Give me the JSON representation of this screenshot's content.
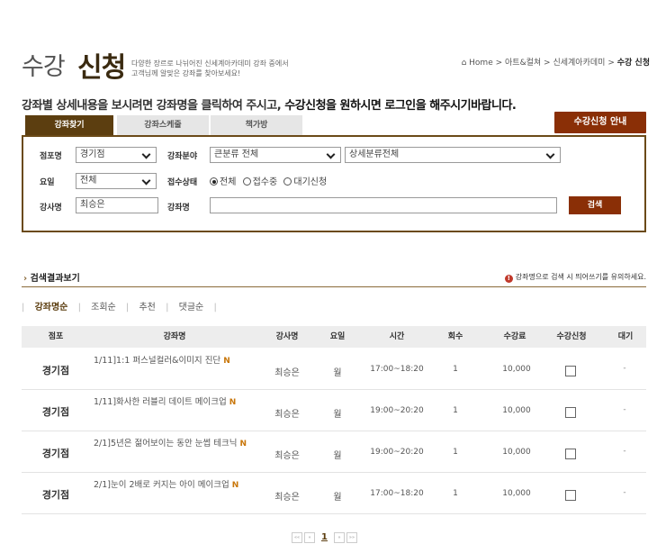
{
  "header": {
    "title_light": "수강",
    "title_strong": "신청",
    "desc_line1": "다양한 장르로 나뉘어진 신세계아카데미 강좌 중에서",
    "desc_line2": "고객님께 알맞은 강좌를 찾아보세요!",
    "breadcrumb": {
      "home": "Home",
      "sep": ">",
      "level1": "아트&컬쳐",
      "level2": "신세계아카데미",
      "current": "수강 신청"
    }
  },
  "notice": {
    "part1": "강좌별 상세내용을 보시려면 강좌명을 클릭하여 주시고, ",
    "part2": "수강신청을 원하시면 로그인을 해주시기바랍니다."
  },
  "tabs": [
    {
      "label": "강좌찾기",
      "active": true
    },
    {
      "label": "강좌스케줄",
      "active": false
    },
    {
      "label": "책가방",
      "active": false
    }
  ],
  "guide_button": "수강신청 안내",
  "search": {
    "branch_label": "점포명",
    "branch_value": "경기점",
    "field_label": "강좌분야",
    "field_major": "큰분류 전체",
    "field_minor": "상세분류전체",
    "day_label": "요일",
    "day_value": "전체",
    "status_label": "접수상태",
    "status_options": [
      "전체",
      "접수중",
      "대기신청"
    ],
    "teacher_label": "강사명",
    "teacher_value": "최승은",
    "course_label": "강좌명",
    "course_value": "",
    "search_button": "검색"
  },
  "results": {
    "title": "검색결과보기",
    "warning": "강좌명으로 검색 시 띄어쓰기를 유의하세요.",
    "sort": [
      "강좌명순",
      "조회순",
      "추천",
      "댓글순"
    ],
    "columns": [
      "점포",
      "강좌명",
      "강사명",
      "요일",
      "시간",
      "회수",
      "수강료",
      "수강신청",
      "대기"
    ],
    "new_badge": "N",
    "rows": [
      {
        "branch": "경기점",
        "name": "1/11]1:1 퍼스널컬러&이미지 진단",
        "teacher": "최승은",
        "day": "월",
        "time": "17:00~18:20",
        "count": "1",
        "fee": "10,000",
        "wait": "-"
      },
      {
        "branch": "경기점",
        "name": "1/11]화사한 러블리 데이트 메이크업",
        "teacher": "최승은",
        "day": "월",
        "time": "19:00~20:20",
        "count": "1",
        "fee": "10,000",
        "wait": "-"
      },
      {
        "branch": "경기점",
        "name": "2/1]5년은 젊어보이는 동안 눈썹 테크닉",
        "teacher": "최승은",
        "day": "월",
        "time": "19:00~20:20",
        "count": "1",
        "fee": "10,000",
        "wait": "-"
      },
      {
        "branch": "경기점",
        "name": "2/1]눈이 2배로 커지는 아이 메이크업",
        "teacher": "최승은",
        "day": "월",
        "time": "17:00~18:20",
        "count": "1",
        "fee": "10,000",
        "wait": "-"
      }
    ]
  },
  "pager": {
    "first": "««",
    "prev": "«",
    "current": "1",
    "next": "»",
    "last": "»»"
  }
}
